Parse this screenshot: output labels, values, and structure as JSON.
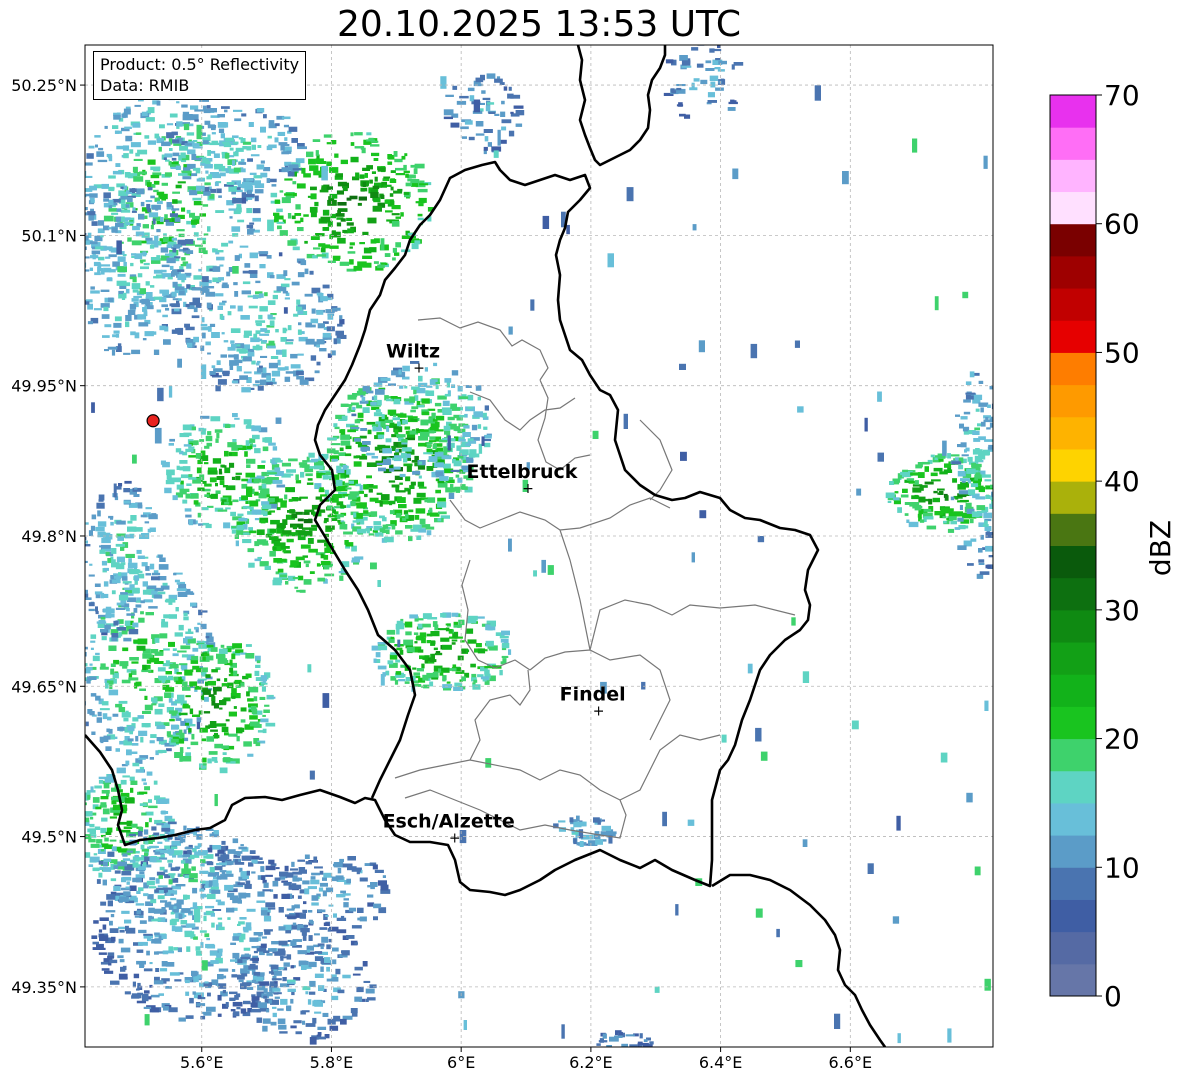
{
  "title": "20.10.2025 13:53 UTC",
  "info": {
    "product": "Product: 0.5° Reflectivity",
    "data": "Data: RMIB"
  },
  "map": {
    "lon_range": [
      5.42,
      6.82
    ],
    "lat_range": [
      49.29,
      50.29
    ],
    "lon_ticks": [
      {
        "value": 5.6,
        "label": "5.6°E"
      },
      {
        "value": 5.8,
        "label": "5.8°E"
      },
      {
        "value": 6.0,
        "label": "6°E"
      },
      {
        "value": 6.2,
        "label": "6.2°E"
      },
      {
        "value": 6.4,
        "label": "6.4°E"
      },
      {
        "value": 6.6,
        "label": "6.6°E"
      }
    ],
    "lat_ticks": [
      {
        "value": 50.25,
        "label": "50.25°N"
      },
      {
        "value": 50.1,
        "label": "50.1°N"
      },
      {
        "value": 49.95,
        "label": "49.95°N"
      },
      {
        "value": 49.8,
        "label": "49.8°N"
      },
      {
        "value": 49.65,
        "label": "49.65°N"
      },
      {
        "value": 49.5,
        "label": "49.5°N"
      },
      {
        "value": 49.35,
        "label": "49.35°N"
      }
    ],
    "grid": true,
    "radar_site": {
      "lon": 5.525,
      "lat": 49.915,
      "color": "#e8231f"
    },
    "cities": [
      {
        "name": "Wiltz",
        "lon": 5.935,
        "lat": 49.968
      },
      {
        "name": "Ettelbruck",
        "lon": 6.103,
        "lat": 49.848
      },
      {
        "name": "Findel",
        "lon": 6.212,
        "lat": 49.626
      },
      {
        "name": "Esch/Alzette",
        "lon": 5.99,
        "lat": 49.499
      }
    ]
  },
  "colorbar": {
    "label": "dBZ",
    "min": 0,
    "max": 70,
    "step": 2.5,
    "ticks": [
      {
        "value": 0,
        "label": "0"
      },
      {
        "value": 10,
        "label": "10"
      },
      {
        "value": 20,
        "label": "20"
      },
      {
        "value": 30,
        "label": "30"
      },
      {
        "value": 40,
        "label": "40"
      },
      {
        "value": 50,
        "label": "50"
      },
      {
        "value": 60,
        "label": "60"
      },
      {
        "value": 70,
        "label": "70"
      }
    ],
    "colors": [
      "#6676a8",
      "#556aa4",
      "#3f5ea4",
      "#4a74b0",
      "#5b9cc8",
      "#68bfd9",
      "#5ed4c3",
      "#3ed26c",
      "#19c41f",
      "#12b21a",
      "#12a016",
      "#0f8a12",
      "#0d7010",
      "#0a5a0c",
      "#4a7612",
      "#aab10b",
      "#fed300",
      "#feb300",
      "#fe9a00",
      "#fe7d00",
      "#e60000",
      "#c10000",
      "#9e0000",
      "#7a0000",
      "#ffe0ff",
      "#ffb4ff",
      "#ff6ef6",
      "#e831ee"
    ]
  }
}
